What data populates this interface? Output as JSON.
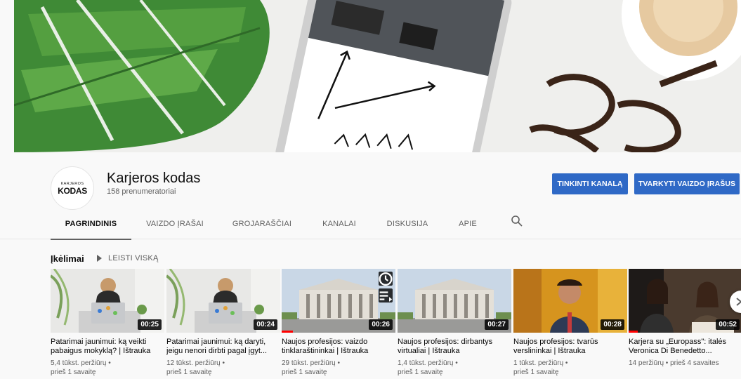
{
  "channel": {
    "avatar_top": "KARJEROS",
    "avatar_main": "KODAS",
    "name": "Karjeros kodas",
    "subscribers": "158 prenumeratoriai"
  },
  "buttons": {
    "customize": "TINKINTI KANALĄ",
    "manage": "TVARKYTI VAIZDO ĮRAŠUS"
  },
  "tabs": [
    {
      "label": "PAGRINDINIS",
      "active": true
    },
    {
      "label": "VAIZDO ĮRAŠAI",
      "active": false
    },
    {
      "label": "GROJARAŠČIAI",
      "active": false
    },
    {
      "label": "KANALAI",
      "active": false
    },
    {
      "label": "DISKUSIJA",
      "active": false
    },
    {
      "label": "APIE",
      "active": false
    }
  ],
  "icons": {
    "search": "search-icon",
    "play": "play-icon",
    "watch_later": "clock-icon",
    "add_queue": "queue-icon",
    "next": "chevron-right-icon"
  },
  "section": {
    "title": "Įkėlimai",
    "play_all": "LEISTI VISKĄ"
  },
  "videos": [
    {
      "title": "Patarimai jaunimui: ką veikti pabaigus mokyklą? | Ištrauka",
      "views": "5,4 tūkst. peržiūrų •",
      "age": "prieš 1 savaitę",
      "duration": "00:25",
      "watched": 0
    },
    {
      "title": "Patarimai jaunimui: ką daryti, jeigu nenori dirbti pagal įgyt...",
      "views": "12 tūkst. peržiūrų •",
      "age": "prieš 1 savaitę",
      "duration": "00:24",
      "watched": 0
    },
    {
      "title": "Naujos profesijos: vaizdo tinklaraštininkai | Ištrauka",
      "views": "29 tūkst. peržiūrų •",
      "age": "prieš 1 savaitę",
      "duration": "00:26",
      "watched": 0.1
    },
    {
      "title": "Naujos profesijos: dirbantys virtualiai | Ištrauka",
      "views": "1,4 tūkst. peržiūrų •",
      "age": "prieš 1 savaitę",
      "duration": "00:27",
      "watched": 0
    },
    {
      "title": "Naujos profesijos: tvarūs verslininkai | Ištrauka",
      "views": "1 tūkst. peržiūrų •",
      "age": "prieš 1 savaitę",
      "duration": "00:28",
      "watched": 0
    },
    {
      "title": "Karjera su „Europass\": italės Veronica Di Benedetto...",
      "views": "14 peržiūrų • prieš 4 savaites",
      "age": "",
      "duration": "00:52",
      "watched": 0.08
    }
  ],
  "colors": {
    "accent": "#2f69c6",
    "progress": "#ff0000"
  }
}
